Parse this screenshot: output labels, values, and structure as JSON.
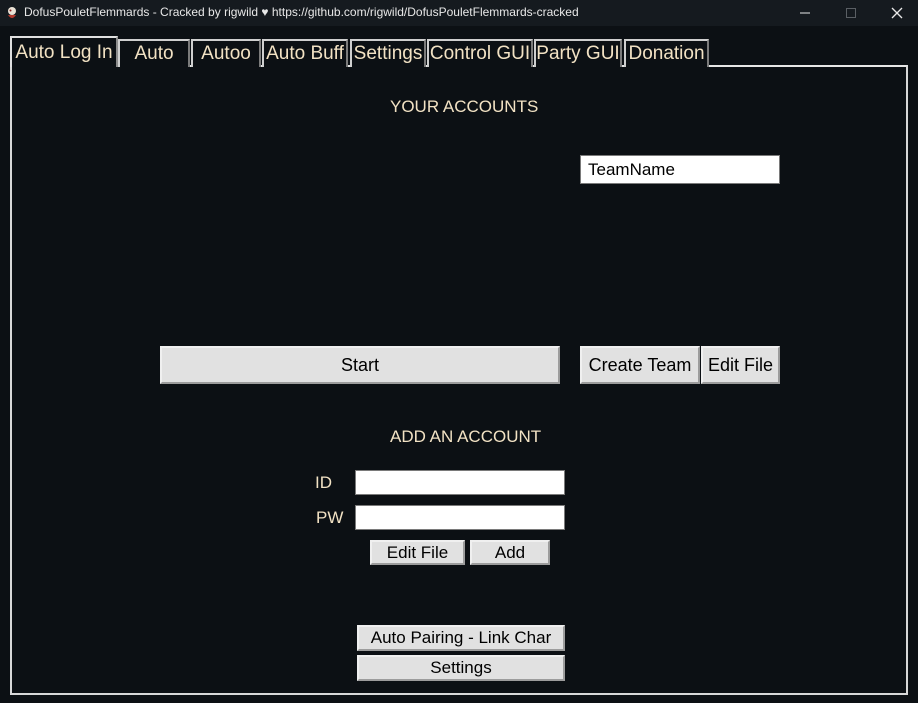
{
  "window": {
    "title": "DofusPouletFlemmards - Cracked by rigwild ♥ https://github.com/rigwild/DofusPouletFlemmards-cracked",
    "minimize_glyph": "—",
    "maximize_glyph": "□",
    "close_glyph": "✕"
  },
  "tabs": [
    {
      "label": "Auto Log In",
      "active": true
    },
    {
      "label": "Auto",
      "active": false
    },
    {
      "label": "Autoo",
      "active": false
    },
    {
      "label": "Auto Buff",
      "active": false
    },
    {
      "label": "Settings",
      "active": false
    },
    {
      "label": "Control GUI",
      "active": false
    },
    {
      "label": "Party GUI",
      "active": false
    },
    {
      "label": "Donation",
      "active": false
    }
  ],
  "accounts": {
    "title": "YOUR ACCOUNTS",
    "team_name_value": "TeamName",
    "start_label": "Start",
    "create_team_label": "Create Team",
    "edit_file_label": "Edit File"
  },
  "add_account": {
    "title": "ADD AN ACCOUNT",
    "id_label": "ID",
    "pw_label": "PW",
    "id_value": "",
    "pw_value": "",
    "edit_file_label": "Edit File",
    "add_label": "Add"
  },
  "bottom": {
    "auto_pairing_label": "Auto Pairing - Link Char",
    "settings_label": "Settings"
  }
}
